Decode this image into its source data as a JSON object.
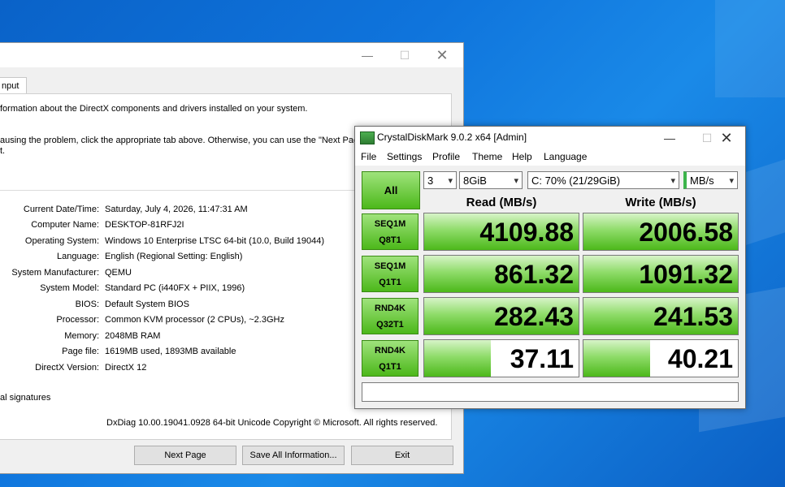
{
  "dxdiag": {
    "tab_label": "nput",
    "intro_line1": "formation about the DirectX components and drivers installed on your system.",
    "intro_line2": "ausing the problem, click the appropriate tab above.  Otherwise, you can use the \"Next Page",
    "intro_line3": "t.",
    "info_rows": [
      {
        "label": "Current Date/Time:",
        "value": "Saturday, July 4, 2026, 11:47:31 AM"
      },
      {
        "label": "Computer Name:",
        "value": "DESKTOP-81RFJ2I"
      },
      {
        "label": "Operating System:",
        "value": "Windows 10 Enterprise LTSC 64-bit (10.0, Build 19044)"
      },
      {
        "label": "Language:",
        "value": "English (Regional Setting: English)"
      },
      {
        "label": "System Manufacturer:",
        "value": "QEMU"
      },
      {
        "label": "System Model:",
        "value": "Standard PC (i440FX + PIIX, 1996)"
      },
      {
        "label": "BIOS:",
        "value": "Default System BIOS"
      },
      {
        "label": "Processor:",
        "value": "Common KVM processor (2 CPUs), ~2.3GHz"
      },
      {
        "label": "Memory:",
        "value": "2048MB RAM"
      },
      {
        "label": "Page file:",
        "value": "1619MB used, 1893MB available"
      },
      {
        "label": "DirectX Version:",
        "value": "DirectX 12"
      }
    ],
    "signatures_text": "al signatures",
    "footer": "DxDiag 10.00.19041.0928 64-bit Unicode  Copyright © Microsoft. All rights reserved.",
    "buttons": {
      "next": "Next Page",
      "save": "Save All Information...",
      "exit": "Exit"
    }
  },
  "cdm": {
    "title": "CrystalDiskMark 9.0.2 x64 [Admin]",
    "menu": [
      "File",
      "Settings",
      "Profile",
      "Theme",
      "Help",
      "Language"
    ],
    "all_button": "All",
    "count": "3",
    "size": "8GiB",
    "drive": "C: 70% (21/29GiB)",
    "units": "MB/s",
    "read_header": "Read (MB/s)",
    "write_header": "Write (MB/s)",
    "tests": [
      {
        "line1": "SEQ1M",
        "line2": "Q8T1",
        "read": "4109.88",
        "write": "2006.58",
        "read_fill": 1.0,
        "write_fill": 1.0
      },
      {
        "line1": "SEQ1M",
        "line2": "Q1T1",
        "read": "861.32",
        "write": "1091.32",
        "read_fill": 1.0,
        "write_fill": 1.0
      },
      {
        "line1": "RND4K",
        "line2": "Q32T1",
        "read": "282.43",
        "write": "241.53",
        "read_fill": 1.0,
        "write_fill": 1.0
      },
      {
        "line1": "RND4K",
        "line2": "Q1T1",
        "read": "37.11",
        "write": "40.21",
        "read_fill": 0.43,
        "write_fill": 0.43
      }
    ],
    "comment": ""
  },
  "colors": {
    "accent_green": "#4cb81a",
    "desktop_blue": "#0f74dc"
  }
}
